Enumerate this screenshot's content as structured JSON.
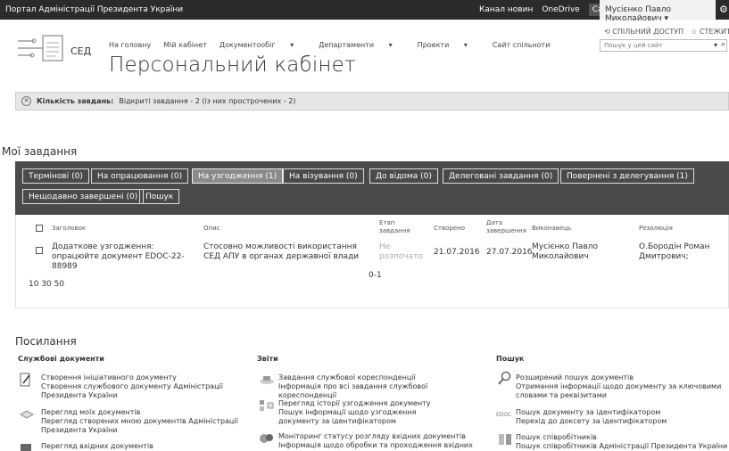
{
  "topbar": {
    "portal": "Портал Адміністрації Президента України",
    "links": [
      "Канал новин",
      "OneDrive",
      "Сайти"
    ],
    "user": "Мусієнко Павло Миколайович"
  },
  "share": {
    "share": "СПІЛЬНИЙ ДОСТУП",
    "follow": "СТЕЖИТИ"
  },
  "logo": {
    "text": "СЕД"
  },
  "nav": {
    "items": [
      "На головну",
      "Мій кабінет",
      "Документообіг",
      "Департаменти",
      "Проекти",
      "Сайт спільноти"
    ]
  },
  "search": {
    "placeholder": "Пошук у цей сайт"
  },
  "page_title": "Персональний кабінет",
  "notice": {
    "label": "Кількість завдань:",
    "text": "Відкриті завдання - 2 (із них прострочених - 2)"
  },
  "tasks": {
    "title": "Мої завдання",
    "tabs_row1": [
      "Термінові (0)",
      "На опрацювання (0)",
      "На узгодження (1)",
      "На візування (0)",
      "До відома (0)",
      "Делеговані завдання (0)",
      "Повернені з делегування (1)"
    ],
    "tabs_row2": [
      "Нещодавно завершені (0)",
      "Пошук"
    ],
    "headers": {
      "title": "Заголовок",
      "desc": "Опис",
      "stage": "Етап завдання",
      "created": "Створено",
      "due": "Дата завершення",
      "executor": "Виконавець",
      "resolution": "Резолюція"
    },
    "row": {
      "title": "Додаткове узгодження: опрацюйте документ EDOC-22-88989",
      "desc": "Стосовно можливості використання СЕД АПУ в органах державної влади",
      "stage": "Не розпочато",
      "created": "21.07.2016",
      "due": "27.07.2016",
      "executor": "Мусієнко Павло Миколайович",
      "resolution": "О.Бородін Роман Дмитрович;"
    },
    "pager": "0-1",
    "page_sizes": "10 30 50"
  },
  "links": {
    "title": "Посилання",
    "col1": {
      "title": "Службові документи",
      "items": [
        "Створення ініціативного документу",
        "Створення службового документу Адміністрації Президента України",
        "Перегляд моїх документів",
        "Перегляд створених мною документів Адміністрації Президента України",
        "Перегляд вхідних документів"
      ]
    },
    "col2": {
      "title": "Звіти",
      "items": [
        "Завдання службової кореспонденції",
        "Інформація про всі завдання службової кореспонденції",
        "Перегляд історії узгодження документу",
        "Пошук інформації щодо узгодження документу за ідентифікатором",
        "Моніторинг статусу розгляду вхідних документів",
        "Інформація щодо обробки та проходження вхідних документів"
      ]
    },
    "col3": {
      "title": "Пошук",
      "items": [
        "Розширений пошук документів",
        "Отримання інформації щодо документу за ключовими словами та реквізитами",
        "Пошук документу за ідентифікатором",
        "Перехід до доксету за ідентифікатором",
        "Пошук співробітників",
        "Пошук співробітників Адміністрації Президента України"
      ],
      "edoc_icon": "EDOC"
    }
  }
}
